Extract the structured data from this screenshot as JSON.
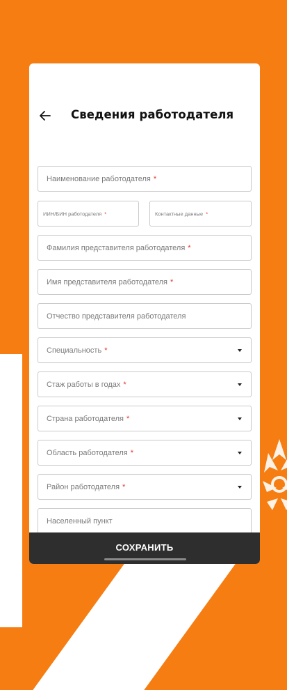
{
  "header": {
    "title": "Сведения работодателя",
    "back_icon": "arrow-left-icon"
  },
  "form": {
    "employer_name": {
      "label": "Наименование работодателя",
      "required_mark": "*"
    },
    "iin_bin": {
      "label": "ИИН/БИН работодателя",
      "required_mark": "*"
    },
    "contact": {
      "label": "Контактные данные",
      "required_mark": "*"
    },
    "rep_surname": {
      "label": "Фамилия представителя работодателя",
      "required_mark": "*"
    },
    "rep_name": {
      "label": "Имя представителя работодателя",
      "required_mark": "*"
    },
    "rep_patronymic": {
      "label": "Отчество представителя работодателя"
    },
    "specialty": {
      "label": "Специальность",
      "required_mark": "*"
    },
    "experience": {
      "label": "Стаж работы в годах",
      "required_mark": "*"
    },
    "country": {
      "label": "Страна работодателя",
      "required_mark": "*"
    },
    "region": {
      "label": "Область работодателя",
      "required_mark": "*"
    },
    "district": {
      "label": "Район работодателя",
      "required_mark": "*"
    },
    "locality": {
      "label": "Населенный пункт"
    }
  },
  "actions": {
    "save_label": "СОХРАНИТЬ"
  },
  "colors": {
    "background": "#f57d12",
    "card": "#ffffff",
    "required": "#e0342a",
    "button": "#2e2e2e"
  }
}
